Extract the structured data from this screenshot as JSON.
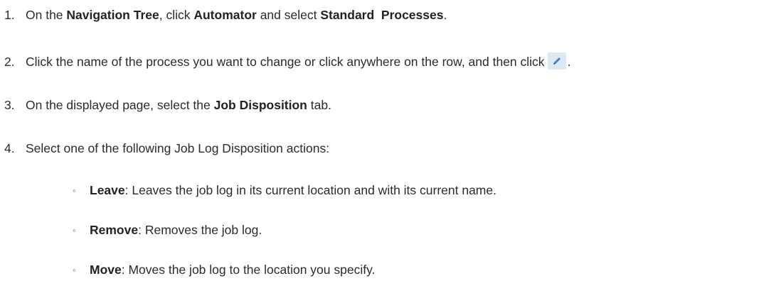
{
  "steps": [
    {
      "number": "1.",
      "parts": [
        "On the ",
        "Navigation Tree",
        ", click ",
        "Automator",
        " and select ",
        "Standard  Processes",
        "."
      ]
    },
    {
      "number": "2.",
      "text": "Click the name of the process you want to change or click anywhere on the row, and then click",
      "icon": "pencil-edit-icon",
      "end": "."
    },
    {
      "number": "3.",
      "parts": [
        "On the displayed page, select the ",
        "Job Disposition",
        " tab."
      ]
    },
    {
      "number": "4.",
      "text": "Select one of the following Job Log Disposition actions:"
    }
  ],
  "options": [
    {
      "bullet": "◦",
      "term": "Leave",
      "desc": ": Leaves the job log in its current location and with its current name."
    },
    {
      "bullet": "◦",
      "term": "Remove",
      "desc": ": Removes the job log."
    },
    {
      "bullet": "◦",
      "term": "Move",
      "desc": ": Moves the job log to the location you specify."
    }
  ],
  "colors": {
    "text": "#2b2b2b",
    "icon_bg": "#dbe9f6",
    "icon_fg": "#4a7fb8"
  }
}
